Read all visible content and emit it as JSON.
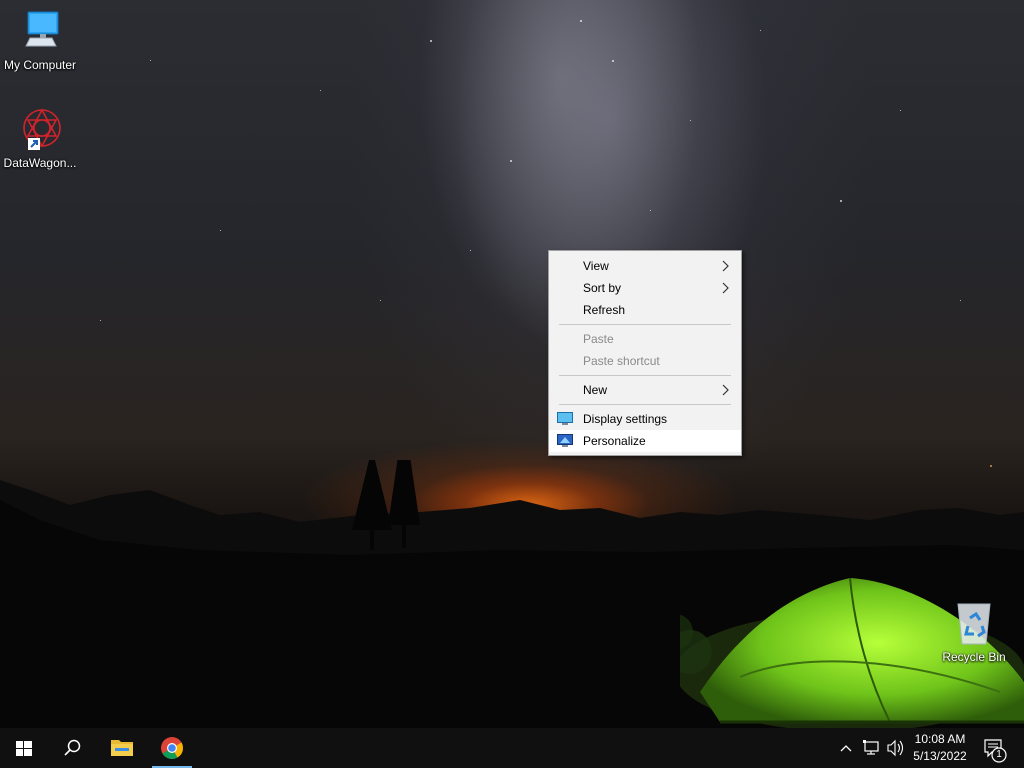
{
  "desktop": {
    "icons": [
      {
        "label": "My Computer",
        "icon": "monitor-icon"
      },
      {
        "label": "DataWagon...",
        "icon": "datawagon-app-icon"
      },
      {
        "label": "Recycle Bin",
        "icon": "recycle-bin-icon"
      }
    ]
  },
  "context_menu": {
    "items": [
      {
        "label": "View",
        "submenu": true,
        "enabled": true
      },
      {
        "label": "Sort by",
        "submenu": true,
        "enabled": true
      },
      {
        "label": "Refresh",
        "submenu": false,
        "enabled": true
      },
      {
        "label": "Paste",
        "submenu": false,
        "enabled": false
      },
      {
        "label": "Paste shortcut",
        "submenu": false,
        "enabled": false
      },
      {
        "label": "New",
        "submenu": true,
        "enabled": true
      },
      {
        "label": "Display settings",
        "submenu": false,
        "enabled": true,
        "icon": "display-settings-icon"
      },
      {
        "label": "Personalize",
        "submenu": false,
        "enabled": true,
        "icon": "personalize-icon",
        "highlighted": true
      }
    ]
  },
  "taskbar": {
    "start": "windows-start-icon",
    "search": "search-icon",
    "pinned": [
      {
        "name": "File Explorer",
        "icon": "folder-icon"
      },
      {
        "name": "Google Chrome",
        "icon": "chrome-icon",
        "active": true
      }
    ],
    "tray": {
      "chevron": "chevron-up-icon",
      "network": "network-icon",
      "volume": "volume-icon"
    },
    "clock": {
      "time": "10:08 AM",
      "date": "5/13/2022"
    },
    "notifications": {
      "icon": "action-center-icon",
      "count": "1"
    }
  },
  "colors": {
    "taskbar_bg": "#101010",
    "menu_bg": "#f2f2f2",
    "tent_green": "#7ed321",
    "accent": "#76b9ed"
  }
}
